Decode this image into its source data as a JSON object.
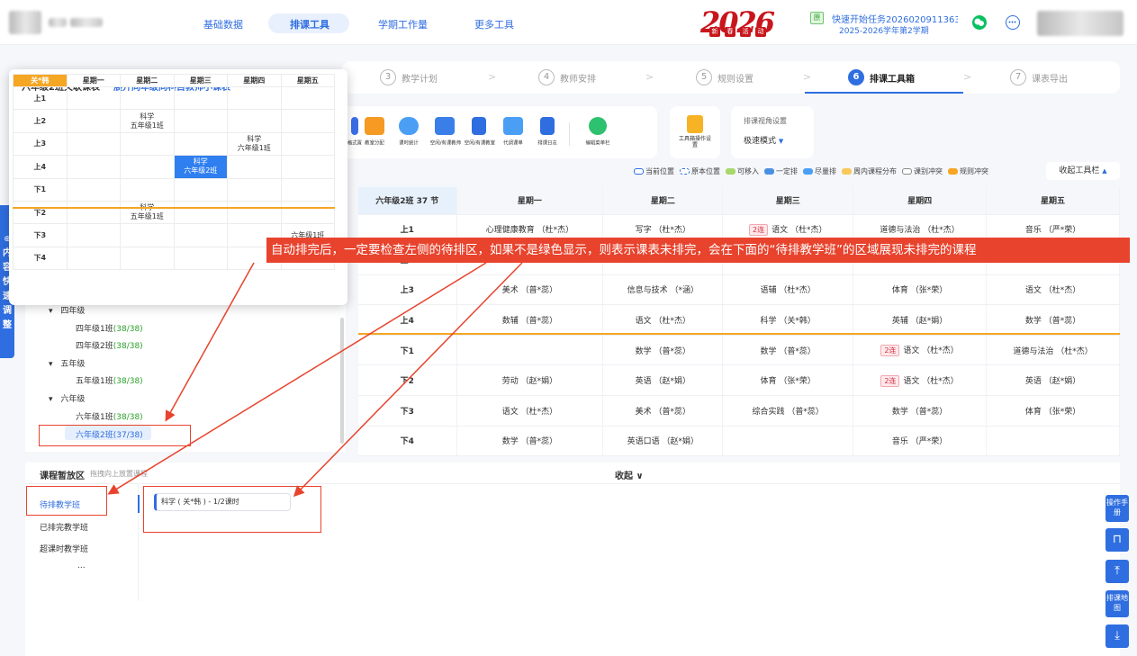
{
  "header": {
    "nav": [
      {
        "label": "基础数据"
      },
      {
        "label": "排课工具"
      },
      {
        "label": "学期工作量"
      },
      {
        "label": "更多工具"
      }
    ],
    "logo": {
      "year": "2026",
      "tags": [
        "新",
        "春",
        "活",
        "动"
      ]
    },
    "task": {
      "tag": "原",
      "title": "快速开始任务2026020911363...",
      "term": "2025-2026学年第2学期"
    }
  },
  "steps": [
    {
      "num": "3",
      "label": "教学计划"
    },
    {
      "num": "4",
      "label": "教师安排"
    },
    {
      "num": "5",
      "label": "规则设置"
    },
    {
      "num": "6",
      "label": "排课工具箱"
    },
    {
      "num": "7",
      "label": "课表导出"
    }
  ],
  "toolbar": {
    "tools": [
      "格式置",
      "教室分配",
      "课时统计",
      "空闲/有课教师",
      "空闲/有课教室",
      "代调课单",
      "排课日志",
      "编辑菜单栏"
    ],
    "guide": "工具箱操作设置",
    "view_title": "排课视角设置",
    "view_mode": "极速模式",
    "collapse": "收起工具栏"
  },
  "legend": [
    {
      "label": "当前位置",
      "color": "#ffffff",
      "border": "#2f6ee0"
    },
    {
      "label": "原本位置",
      "color": "#ffffff",
      "border": "#2f6ee0"
    },
    {
      "label": "可移入",
      "color": "#a6d86a"
    },
    {
      "label": "一定排",
      "color": "#4a90e2"
    },
    {
      "label": "尽量排",
      "color": "#4a9ff5"
    },
    {
      "label": "周内课程分布",
      "color": "#f8c85a"
    },
    {
      "label": "课别冲突",
      "color": "#ffffff",
      "border": "#888888"
    },
    {
      "label": "规则冲突",
      "color": "#f5a623"
    }
  ],
  "popup": {
    "title": "六年级2班关联课表",
    "link": "展开同年级同科目教师小课表",
    "corner": "关*韩",
    "days": [
      "星期一",
      "星期二",
      "星期三",
      "星期四",
      "星期五"
    ],
    "rows": [
      {
        "p": "上1",
        "c": [
          [],
          [],
          [],
          [],
          []
        ]
      },
      {
        "p": "上2",
        "c": [
          [],
          [
            "科学",
            "五年级1班"
          ],
          [],
          [],
          []
        ]
      },
      {
        "p": "上3",
        "c": [
          [],
          [],
          [],
          [
            "科学",
            "六年级1班"
          ],
          []
        ]
      },
      {
        "p": "上4",
        "c": [
          [],
          [],
          [
            "科学",
            "六年级2班"
          ],
          [],
          []
        ]
      },
      {
        "p": "下1",
        "c": [
          [],
          [],
          [],
          [],
          []
        ]
      },
      {
        "p": "下2",
        "c": [
          [],
          [
            "科学",
            "五年级1班"
          ],
          [],
          [],
          []
        ]
      },
      {
        "p": "下3",
        "c": [
          [],
          [],
          [],
          [],
          [
            "六年级1班"
          ]
        ]
      },
      {
        "p": "下4",
        "c": [
          [],
          [],
          [],
          [],
          []
        ]
      }
    ]
  },
  "side_tab": "内容快速调整",
  "banner": "自动排完后，一定要检查左侧的待排区，如果不是绿色显示，则表示课表未排完，会在下面的“待排教学班”的区域展现未排完的课程",
  "tree": {
    "items": [
      {
        "label": "四年级",
        "level": 0
      },
      {
        "label": "四年级1班",
        "count": "(38/38)",
        "level": 1
      },
      {
        "label": "四年级2班",
        "count": "(38/38)",
        "level": 1
      },
      {
        "label": "五年级",
        "level": 0
      },
      {
        "label": "五年级1班",
        "count": "(38/38)",
        "level": 1
      },
      {
        "label": "六年级",
        "level": 0
      },
      {
        "label": "六年级1班",
        "count": "(38/38)",
        "level": 1
      },
      {
        "label": "六年级2班",
        "count": "(37/38)",
        "level": 1
      }
    ]
  },
  "timetable": {
    "header": "六年级2班 37 节",
    "days": [
      "星期一",
      "星期二",
      "星期三",
      "星期四",
      "星期五"
    ],
    "rows": [
      {
        "p": "上1",
        "c": [
          "心理健康教育 （杜*杰）",
          "写字 （杜*杰）",
          "2连|语文 （杜*杰）",
          "道德与法治 （杜*杰）",
          "音乐 （严*荣）"
        ]
      },
      {
        "p": "上2",
        "c": [
          "",
          "",
          "",
          "",
          ""
        ]
      },
      {
        "p": "上3",
        "c": [
          "美术 （普*蕊）",
          "信息与技术 （*涵）",
          "语辅 （杜*杰）",
          "体育 （张*荣）",
          "语文 （杜*杰）"
        ]
      },
      {
        "p": "上4",
        "c": [
          "数辅 （普*蕊）",
          "语文 （杜*杰）",
          "科学 （关*韩）",
          "英辅 （赵*娟）",
          "数学 （普*蕊）"
        ]
      },
      {
        "p": "下1",
        "c": [
          "",
          "数学 （普*蕊）",
          "数学 （普*蕊）",
          "2连|语文 （杜*杰）",
          "道德与法治 （杜*杰）"
        ]
      },
      {
        "p": "下2",
        "c": [
          "劳动 （赵*娟）",
          "英语 （赵*娟）",
          "体育 （张*荣）",
          "2连|语文 （杜*杰）",
          "英语 （赵*娟）"
        ]
      },
      {
        "p": "下3",
        "c": [
          "语文 （杜*杰）",
          "美术 （普*蕊）",
          "综合实践 （普*蕊）",
          "数学 （普*蕊）",
          "体育 （张*荣）"
        ]
      },
      {
        "p": "下4",
        "c": [
          "数学 （普*蕊）",
          "英语口语 （赵*娟）",
          "",
          "音乐 （严*荣）",
          ""
        ]
      }
    ]
  },
  "staging": {
    "title": "课程暂放区",
    "hint": "拖拽向上放置课程",
    "collapse": "收起",
    "menu": [
      "待排教学班",
      "已排完教学班",
      "超课时教学班",
      "..."
    ],
    "course": "科学 ( 关*韩 ) - 1/2课时"
  },
  "right_buttons": [
    "操作手册",
    "排课地图"
  ]
}
